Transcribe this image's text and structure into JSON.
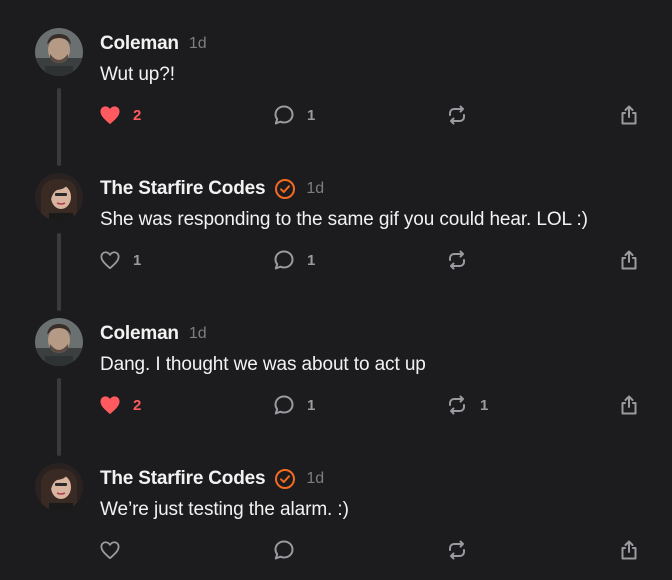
{
  "colors": {
    "background": "#1c1c1e",
    "text": "#f2f2f2",
    "muted": "#7d7d82",
    "icon": "#9a9a9f",
    "like_active": "#ff5a5f",
    "verified_badge": "#f26b22",
    "thread_line": "#3a3a3c"
  },
  "posts": [
    {
      "author": "Coleman",
      "verified": false,
      "time": "1d",
      "text": "Wut up?!",
      "liked": true,
      "likes": "2",
      "replies": "1",
      "reposts": "",
      "icons": [
        "heart-filled-icon",
        "comment-icon",
        "repost-icon",
        "share-icon"
      ]
    },
    {
      "author": "The Starfire Codes",
      "verified": true,
      "time": "1d",
      "text": "She was responding to the same gif you could hear. LOL :)",
      "liked": false,
      "likes": "1",
      "replies": "1",
      "reposts": "",
      "icons": [
        "heart-outline-icon",
        "comment-icon",
        "repost-icon",
        "share-icon"
      ]
    },
    {
      "author": "Coleman",
      "verified": false,
      "time": "1d",
      "text": "Dang. I thought we was about to act up",
      "liked": true,
      "likes": "2",
      "replies": "1",
      "reposts": "1",
      "icons": [
        "heart-filled-icon",
        "comment-icon",
        "repost-icon",
        "share-icon"
      ]
    },
    {
      "author": "The Starfire Codes",
      "verified": true,
      "time": "1d",
      "text": "We’re just testing the alarm. :)",
      "liked": false,
      "likes": "",
      "replies": "",
      "reposts": "",
      "icons": [
        "heart-outline-icon",
        "comment-icon",
        "repost-icon",
        "share-icon"
      ]
    }
  ]
}
